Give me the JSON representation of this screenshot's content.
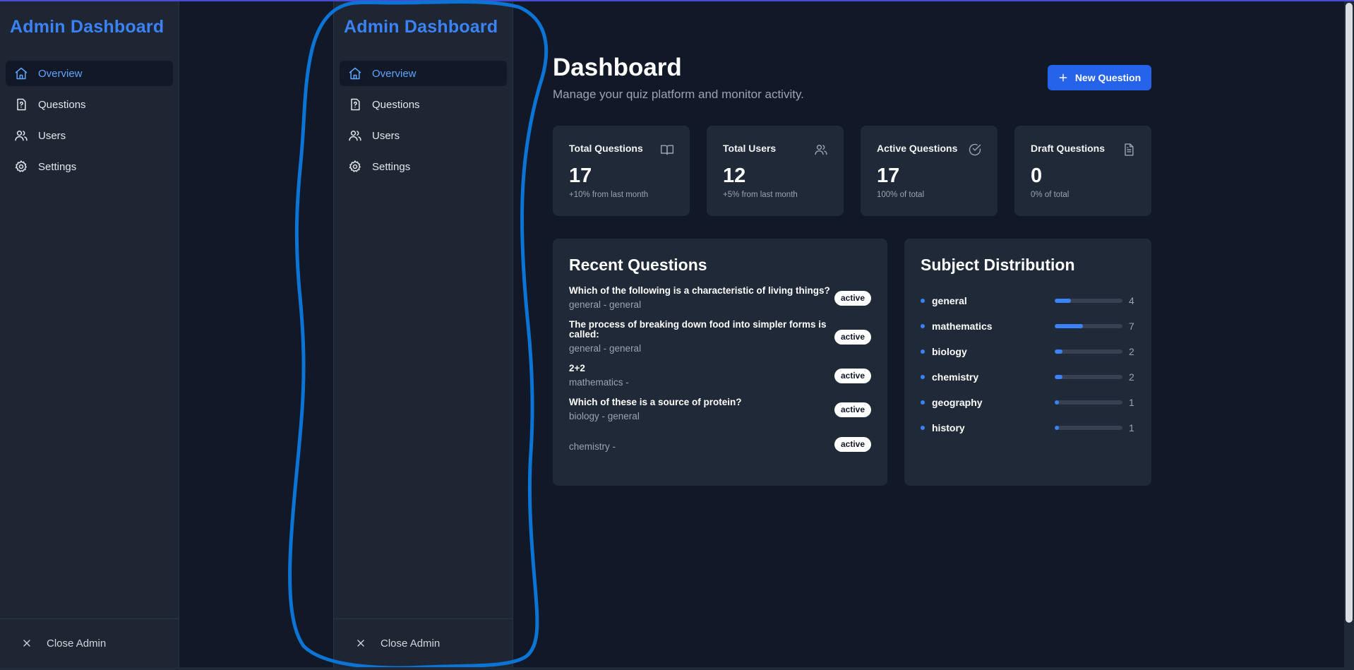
{
  "sidebar": {
    "title": "Admin Dashboard",
    "items": [
      {
        "label": "Overview",
        "icon": "home-icon",
        "active": true
      },
      {
        "label": "Questions",
        "icon": "question-file-icon",
        "active": false
      },
      {
        "label": "Users",
        "icon": "users-icon",
        "active": false
      },
      {
        "label": "Settings",
        "icon": "gear-icon",
        "active": false
      }
    ],
    "close_label": "Close Admin"
  },
  "header": {
    "title": "Dashboard",
    "subtitle": "Manage your quiz platform and monitor activity.",
    "new_button": "New Question"
  },
  "stats": [
    {
      "label": "Total Questions",
      "value": "17",
      "note": "+10% from last month",
      "icon": "book-icon"
    },
    {
      "label": "Total Users",
      "value": "12",
      "note": "+5% from last month",
      "icon": "users-icon"
    },
    {
      "label": "Active Questions",
      "value": "17",
      "note": "100% of total",
      "icon": "check-circle-icon"
    },
    {
      "label": "Draft Questions",
      "value": "0",
      "note": "0% of total",
      "icon": "document-icon"
    }
  ],
  "recent": {
    "title": "Recent Questions",
    "items": [
      {
        "question": "Which of the following is a characteristic of living things?",
        "meta": "general - general",
        "status": "active"
      },
      {
        "question": "The process of breaking down food into simpler forms is called:",
        "meta": "general - general",
        "status": "active"
      },
      {
        "question": "2+2",
        "meta": "mathematics -",
        "status": "active"
      },
      {
        "question": "Which of these is a source of protein?",
        "meta": "biology - general",
        "status": "active"
      },
      {
        "question": "",
        "meta": "chemistry -",
        "status": "active"
      }
    ]
  },
  "subjects": {
    "title": "Subject Distribution",
    "max": 17,
    "items": [
      {
        "name": "general",
        "count": 4
      },
      {
        "name": "mathematics",
        "count": 7
      },
      {
        "name": "biology",
        "count": 2
      },
      {
        "name": "chemistry",
        "count": 2
      },
      {
        "name": "geography",
        "count": 1
      },
      {
        "name": "history",
        "count": 1
      }
    ]
  },
  "colors": {
    "accent": "#3b82f6",
    "button": "#2563eb",
    "background": "#111827",
    "card": "#1f2937",
    "annotation": "#0b74d4"
  }
}
